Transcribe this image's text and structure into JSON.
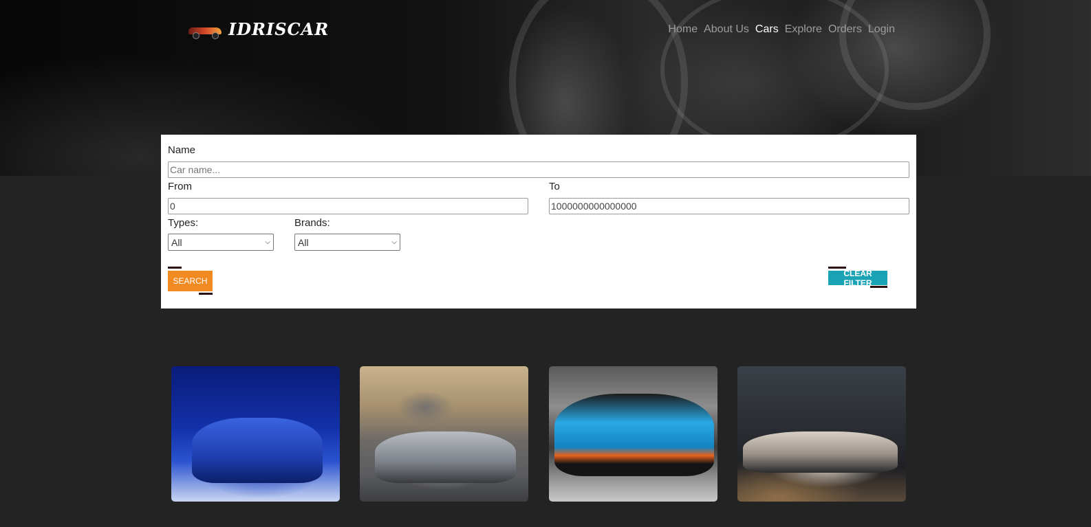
{
  "header": {
    "logo_text": "IDRISCAR",
    "nav": [
      {
        "label": "Home",
        "active": false
      },
      {
        "label": "About Us",
        "active": false
      },
      {
        "label": "Cars",
        "active": true
      },
      {
        "label": "Explore",
        "active": false
      },
      {
        "label": "Orders",
        "active": false
      },
      {
        "label": "Login",
        "active": false
      }
    ]
  },
  "filter": {
    "name_label": "Name",
    "name_placeholder": "Car name...",
    "from_label": "From",
    "from_value": "0",
    "to_label": "To",
    "to_value": "1000000000000000",
    "types_label": "Types:",
    "types_selected": "All",
    "brands_label": "Brands:",
    "brands_selected": "All",
    "search_label": "SEARCH",
    "clear_label": "CLEAR FILTER"
  },
  "colors": {
    "page_bg": "#232323",
    "search_button": "#f28a22",
    "clear_button": "#1aa3b5",
    "nav_active": "#ffffff",
    "nav_inactive": "#9d9d9d"
  },
  "cars": [
    {
      "image": "blue-bmw-sedan"
    },
    {
      "image": "silver-bmw-i8-doors-open"
    },
    {
      "image": "blue-lamborghini-huracan"
    },
    {
      "image": "silver-lamborghini-speedster"
    }
  ]
}
